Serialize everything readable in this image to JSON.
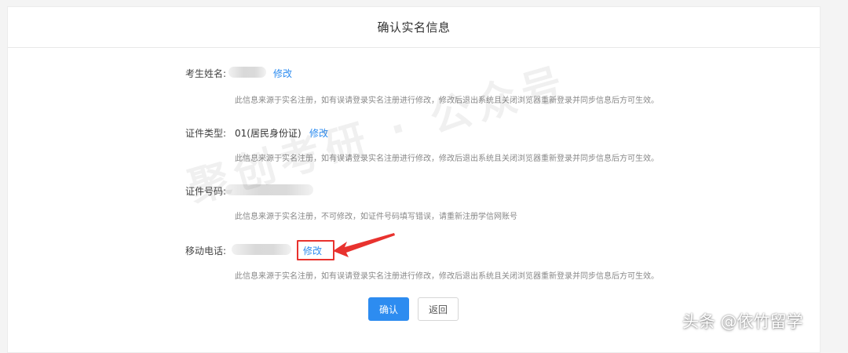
{
  "page": {
    "title": "确认实名信息"
  },
  "fields": [
    {
      "label": "考生姓名:",
      "value": "",
      "edit_label": "修改",
      "note": "此信息来源于实名注册，如有误请登录实名注册进行修改，修改后退出系统且关闭浏览器重新登录并同步信息后方可生效。"
    },
    {
      "label": "证件类型:",
      "value": "01(居民身份证)",
      "edit_label": "修改",
      "note": "此信息来源于实名注册，如有误请登录实名注册进行修改，修改后退出系统且关闭浏览器重新登录并同步信息后方可生效。"
    },
    {
      "label": "证件号码:",
      "value": "",
      "note": "此信息来源于实名注册，不可修改，如证件号码填写错误，请重新注册学信网账号"
    },
    {
      "label": "移动电话:",
      "value": "",
      "edit_label": "修改",
      "note": "此信息来源于实名注册，如有误请登录实名注册进行修改，修改后退出系统且关闭浏览器重新登录并同步信息后方可生效。"
    }
  ],
  "actions": {
    "confirm_label": "确认",
    "back_label": "返回"
  },
  "overlay": {
    "watermark": "聚创考研 · 公众号",
    "corner_brand": "头条 @依竹留学"
  },
  "colors": {
    "link": "#2d8cf0",
    "primary": "#2d8cf0",
    "highlight": "#e8322e"
  }
}
